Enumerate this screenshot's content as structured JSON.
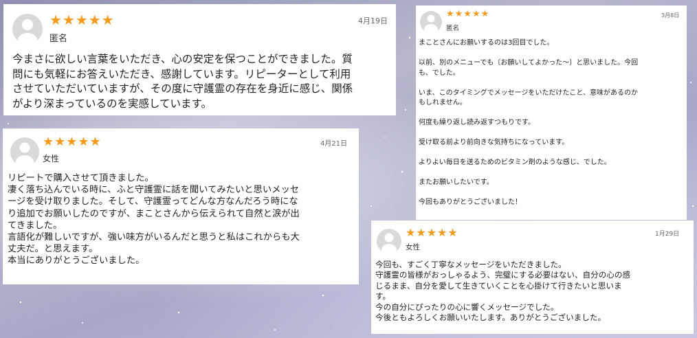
{
  "reviews": [
    {
      "rating_text": "★★★★★",
      "name": "匿名",
      "date": "4月19日",
      "body": "今まさに欲しい言葉をいただき、心の安定を保つことができました。質\n問にも気軽にお答えいただき、感謝しています。リピーターとして利用\nさせていただいていますが、その度に守護霊の存在を身近に感じ、関係\nがより深まっているのを実感しています。"
    },
    {
      "rating_text": "★★★★★",
      "name": "女性",
      "date": "4月21日",
      "body": "リピートで購入させて頂きました。\n凄く落ち込んでいる時に、ふと守護霊に話を聞いてみたいと思いメッセ\nージを受け取りました。そして、守護霊ってどんな方なんだろう時にな\nり追加でお願いしたのですが、まことさんから伝えられて自然と涙が出\nてきました。\n言語化が難しいですが、強い味方がいるんだと思うと私はこれからも大\n丈夫だ。と思えます。\n本当にありがとうございました。"
    },
    {
      "rating_text": "★★★★★",
      "name": "匿名",
      "date": "3月8日",
      "paragraphs": [
        "まことさんにお願いするのは3回目でした。",
        "以前、別のメニューでも〔お願いしてよかった〜〕と思いました。今回\nも、でした。",
        "いま、このタイミングでメッセージをいただけたこと、意味があるのか\nもしれません。",
        "何度も繰り返し読み返すつもりです。",
        "受け取る前より前向きな気持ちになっています。",
        "よりよい毎日を送るためのビタミン剤のような感じ、でした。",
        "またお願いしたいです。",
        "今回もありがとうございました！"
      ]
    },
    {
      "rating_text": "★★★★★",
      "name": "女性",
      "date": "1月29日",
      "body": "今回も、すごく丁寧なメッセージをいただきました。\n守護霊の皆様がおっしゃるよう、完璧にする必要はない、自分の心の感\nじるまま、自分を愛して生きていくことを心掛けて行きたいと思いま\nす。\n今の自分にぴったりの心に響くメッセージでした。\n今後ともよろしくお願いいたします。ありがとうございました。"
    }
  ],
  "icons": {
    "avatar": "person-placeholder-icon",
    "star": "star-icon"
  },
  "colors": {
    "star": "#f59a1b",
    "avatar_bg": "#d9d9d9",
    "avatar_fg": "#ffffff"
  }
}
